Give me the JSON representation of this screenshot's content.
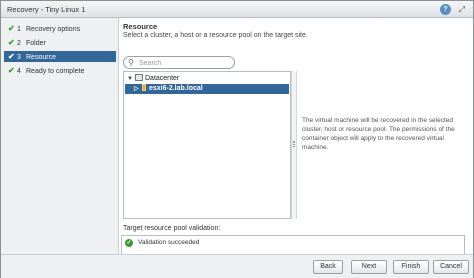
{
  "window": {
    "title": "Recovery - Tiny Linux 1",
    "help_icon": "help-icon",
    "expand_icon": "expand-icon"
  },
  "steps": [
    {
      "number": "1",
      "label": "Recovery options",
      "done": true
    },
    {
      "number": "2",
      "label": "Folder",
      "done": true
    },
    {
      "number": "3",
      "label": "Resource",
      "done": true,
      "active": true
    },
    {
      "number": "4",
      "label": "Ready to complete",
      "done": true
    }
  ],
  "page": {
    "title": "Resource",
    "subtitle": "Select a cluster, a host or a resource pool on the target site."
  },
  "search": {
    "placeholder": "Search",
    "value": ""
  },
  "tree": {
    "root": "Datacenter",
    "child": "esxi6-2.lab.local"
  },
  "info_text": "The virtual machine will be recovered in the selected cluster, host or resource pool. The permissions of the container object will apply to the recovered virtual machine.",
  "validation": {
    "label": "Target resource pool validation:",
    "status": "Validation succeeded"
  },
  "buttons": {
    "back": "Back",
    "next": "Next",
    "finish": "Finish",
    "cancel": "Cancel"
  },
  "colors": {
    "accent": "#336699",
    "success": "#3a9a2f"
  }
}
